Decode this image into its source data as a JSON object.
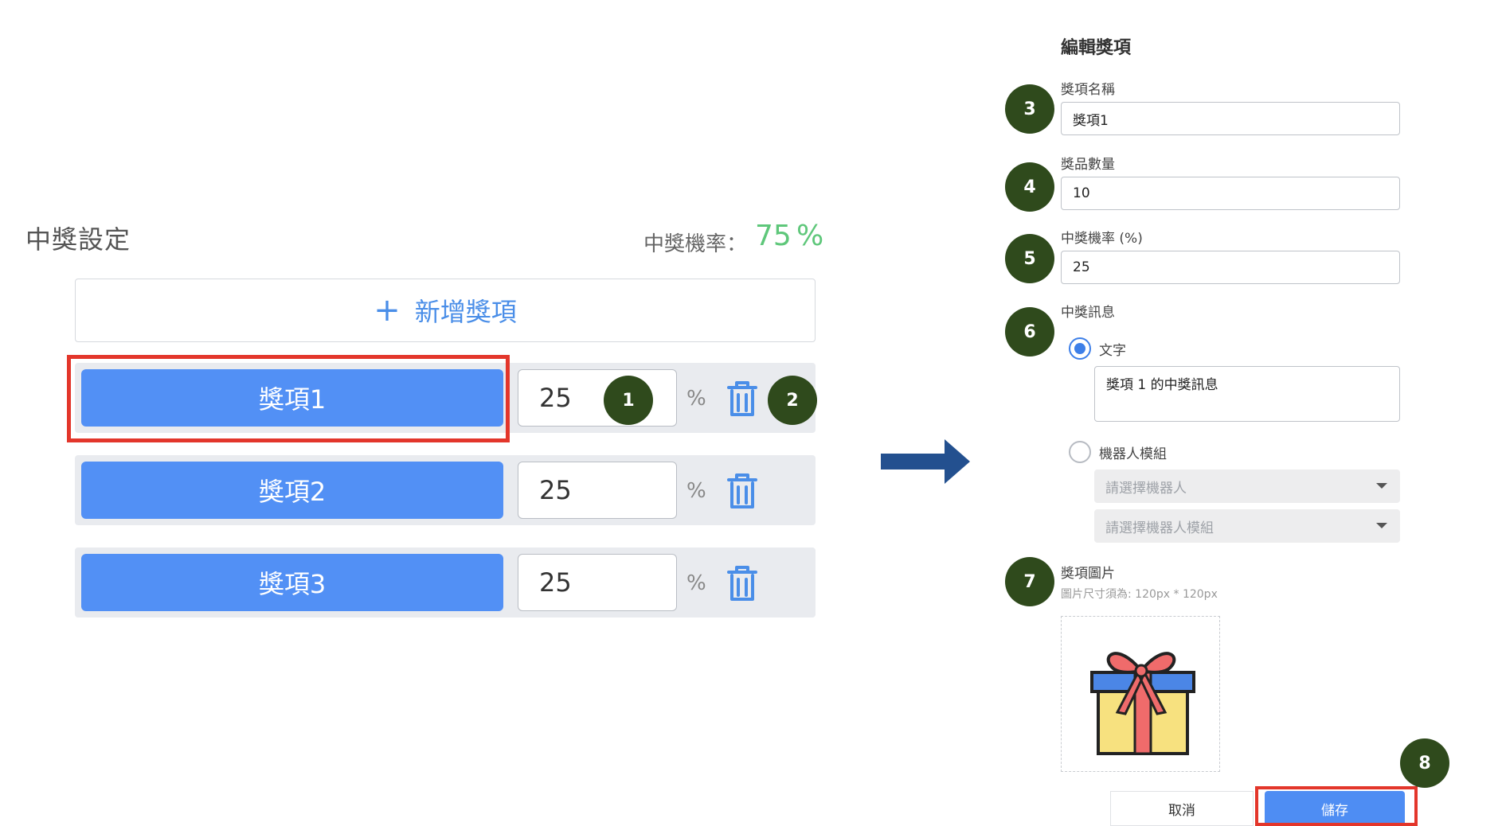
{
  "left": {
    "section_title": "中獎設定",
    "total_rate_label": "中獎機率：",
    "total_rate_value": "75",
    "total_rate_unit": "%",
    "add_button": {
      "icon": "plus-icon",
      "label": "新增獎項"
    },
    "prizes": [
      {
        "label": "獎項1",
        "rate": "25",
        "unit": "%",
        "delete_icon": "trash-icon"
      },
      {
        "label": "獎項2",
        "rate": "25",
        "unit": "%",
        "delete_icon": "trash-icon"
      },
      {
        "label": "獎項3",
        "rate": "25",
        "unit": "%",
        "delete_icon": "trash-icon"
      }
    ]
  },
  "badges": [
    "1",
    "2",
    "3",
    "4",
    "5",
    "6",
    "7",
    "8"
  ],
  "right": {
    "title": "編輯獎項",
    "name": {
      "label": "獎項名稱",
      "value": "獎項1"
    },
    "quantity": {
      "label": "獎品數量",
      "value": "10"
    },
    "rate": {
      "label": "中獎機率 (%)",
      "value": "25"
    },
    "message": {
      "label": "中獎訊息",
      "option_text": {
        "label": "文字",
        "checked": true,
        "value": "獎項 1 的中獎訊息"
      },
      "option_bot": {
        "label": "機器人模組",
        "checked": false,
        "bot_placeholder": "請選擇機器人",
        "module_placeholder": "請選擇機器人模組"
      }
    },
    "image": {
      "label": "獎項圖片",
      "hint": "圖片尺寸須為: 120px * 120px",
      "icon": "gift-icon"
    },
    "cancel_label": "取消",
    "save_label": "儲存"
  },
  "colors": {
    "prize_button": "#5290f5",
    "accent_green": "#5ec77a",
    "badge": "#2f4a1c",
    "highlight": "#e3362b",
    "arrow": "#23508f"
  }
}
